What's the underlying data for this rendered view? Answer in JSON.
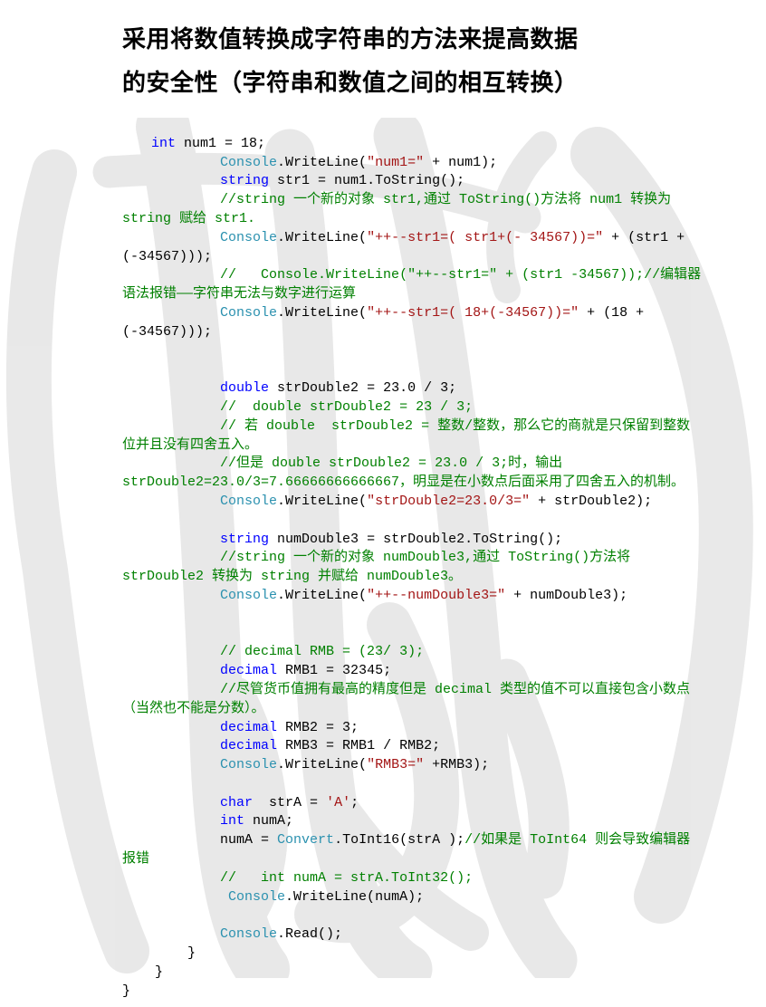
{
  "title": {
    "line1": "采用将数值转换成字符串的方法来提高数据",
    "line2": "的安全性（字符串和数值之间的相互转换）"
  },
  "code": {
    "kw_int": "int",
    "kw_string": "string",
    "kw_double": "double",
    "kw_decimal": "decimal",
    "kw_char": "char",
    "type_console": "Console",
    "type_convert": "Convert",
    "l1_a": " num1 = 18;",
    "l2_a": ".WriteLine(",
    "l2_s": "\"num1=\"",
    "l2_b": " + num1);",
    "l3_a": " str1 = num1.ToString();",
    "l4_c": "//string 一个新的对象 str1,通过 ToString()方法将 num1 转换为 string 赋给 str1.",
    "l5_a": ".WriteLine(",
    "l5_s": "\"++--str1=( str1+(- 34567))=\"",
    "l5_b": " + (str1 + (-34567)));",
    "l6_c": "//   Console.WriteLine(\"++--str1=\" + (str1 -34567));//编辑器语法报错——字符串无法与数字进行运算",
    "l7_a": ".WriteLine(",
    "l7_s": "\"++--str1=( 18+(-34567))=\"",
    "l7_b": " + (18 + (-34567)));",
    "l8_a": " strDouble2 = 23.0 / 3;",
    "l9_c": "//  double strDouble2 = 23 / 3;",
    "l10_c": "// 若 double  strDouble2 = 整数/整数，那么它的商就是只保留到整数位并且没有四舍五入。",
    "l11_c": "//但是 double strDouble2 = 23.0 / 3;时，输出 strDouble2=23.0/3=7.66666666666667，明显是在小数点后面采用了四舍五入的机制。",
    "l12_a": ".WriteLine(",
    "l12_s": "\"strDouble2=23.0/3=\"",
    "l12_b": " + strDouble2);",
    "l13_a": " numDouble3 = strDouble2.ToString();",
    "l14_c": "//string 一个新的对象 numDouble3,通过 ToString()方法将 strDouble2 转换为 string 并赋给 numDouble3。",
    "l15_a": ".WriteLine(",
    "l15_s": "\"++--numDouble3=\"",
    "l15_b": " + numDouble3);",
    "l16_c": "// decimal RMB = (23/ 3);",
    "l17_a": " RMB1 = 32345;",
    "l18_c": "//尽管货币值拥有最高的精度但是 decimal 类型的值不可以直接包含小数点（当然也不能是分数）。",
    "l19_a": " RMB2 = 3;",
    "l20_a": " RMB3 = RMB1 / RMB2;",
    "l21_a": ".WriteLine(",
    "l21_s": "\"RMB3=\"",
    "l21_b": " +RMB3);",
    "l22_a": "  strA = ",
    "l22_s": "'A'",
    "l22_b": ";",
    "l23_a": " numA;",
    "l24_a": "            numA = ",
    "l24_b": ".ToInt16(strA );",
    "l24_c": "//如果是 ToInt64 则会导致编辑器报错",
    "l25_c": "//   int numA = strA.ToInt32();",
    "l26_a": ".WriteLine(numA);",
    "l27_a": ".Read();",
    "brace_close1": "        }",
    "brace_close2": "    }",
    "brace_close3": "}"
  }
}
